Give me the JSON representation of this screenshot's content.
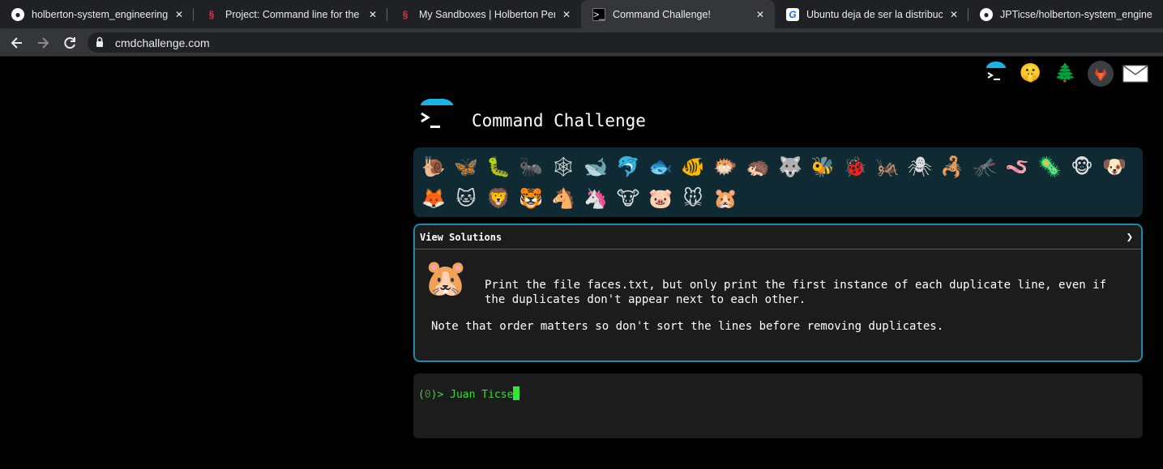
{
  "browser": {
    "tabs": [
      {
        "title": "holberton-system_engineering-d",
        "icon": "github-icon",
        "active": false
      },
      {
        "title": "Project: Command line for the wi",
        "icon": "holberton-icon",
        "active": false
      },
      {
        "title": "My Sandboxes | Holberton Peru |",
        "icon": "holberton-icon",
        "active": false
      },
      {
        "title": "Command Challenge!",
        "icon": "terminal-icon",
        "active": true
      },
      {
        "title": "Ubuntu deja de ser la distribució",
        "icon": "genbeta-icon",
        "active": false
      },
      {
        "title": "JPTicse/holberton-system_engine",
        "icon": "github-icon",
        "active": false
      }
    ],
    "close_glyph": "✕",
    "url": "cmdchallenge.com"
  },
  "top_icons": [
    "terminal-umbrella-icon",
    "shushing-face-icon",
    "tree-icon",
    "gitlab-icon",
    "envelope-icon"
  ],
  "header": {
    "title": "Command Challenge"
  },
  "animals": [
    "🐌",
    "🦋",
    "🐛",
    "🐜",
    "🕸",
    "🐋",
    "🐬",
    "🐟",
    "🐠",
    "🐡",
    "🦔",
    "🐺",
    "🐝",
    "🐞",
    "🦗",
    "🕷",
    "🦂",
    "🦟",
    "🪱",
    "🦠",
    "🐵",
    "🐶",
    "🦊",
    "🐱",
    "🦁",
    "🐯",
    "🐴",
    "🦄",
    "🐮",
    "🐷",
    "🐭",
    "🐹"
  ],
  "solutions": {
    "label": "View Solutions",
    "arrow": "❯",
    "challenge_icon": "🐹",
    "description": "Print the file faces.txt, but only print the first instance of each duplicate line, even if the duplicates don't appear next to each other.",
    "note": "Note that order matters so don't sort the lines before removing duplicates."
  },
  "terminal": {
    "prompt_open": "(",
    "prompt_num": "0",
    "prompt_close": ")> ",
    "input": "Juan Ticse"
  }
}
